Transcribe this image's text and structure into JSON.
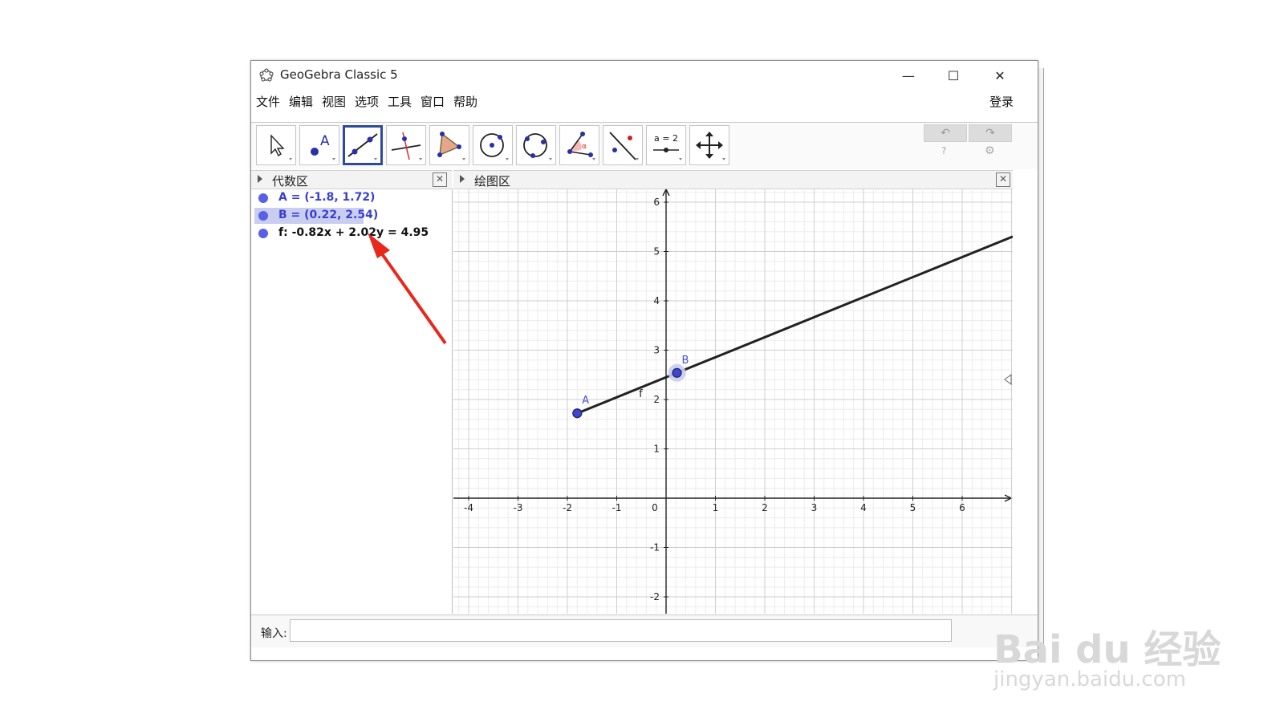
{
  "window": {
    "title": "GeoGebra Classic 5",
    "minimize_glyph": "—",
    "maximize_glyph": "☐",
    "close_glyph": "✕"
  },
  "menu": {
    "items": [
      "文件",
      "编辑",
      "视图",
      "选项",
      "工具",
      "窗口",
      "帮助"
    ],
    "login": "登录"
  },
  "toolbar": {
    "tools": [
      {
        "name": "move-tool",
        "icon": "cursor-arrow-icon"
      },
      {
        "name": "point-tool",
        "icon": "point-icon"
      },
      {
        "name": "line-tool",
        "icon": "line-through-points-icon",
        "selected": true
      },
      {
        "name": "perpendicular-line-tool",
        "icon": "perpendicular-line-icon"
      },
      {
        "name": "polygon-tool",
        "icon": "polygon-icon"
      },
      {
        "name": "circle-center-point-tool",
        "icon": "circle-center-icon"
      },
      {
        "name": "circle-three-points-tool",
        "icon": "circle-three-points-icon"
      },
      {
        "name": "angle-tool",
        "icon": "angle-icon"
      },
      {
        "name": "reflect-tool",
        "icon": "reflect-line-icon"
      },
      {
        "name": "slider-tool",
        "icon": "slider-icon",
        "label": "a = 2"
      },
      {
        "name": "move-graphics-view-tool",
        "icon": "move-cross-arrows-icon"
      }
    ],
    "undo_glyph": "↶",
    "redo_glyph": "↷",
    "help_glyph": "?",
    "settings_glyph": "⚙"
  },
  "algebra_view": {
    "title": "代数区",
    "close_glyph": "✕",
    "items": [
      {
        "text": "A = (-1.8, 1.72)",
        "color": "#3a3fcf",
        "selected": false
      },
      {
        "text": "B = (0.22, 2.54)",
        "color": "#3a3fcf",
        "selected": true
      },
      {
        "text": "f: -0.82x + 2.02y = 4.95",
        "color": "#111111",
        "selected": false
      }
    ]
  },
  "graphics_view": {
    "title": "绘图区",
    "close_glyph": "✕",
    "x_ticks": [
      "-4",
      "-3",
      "-2",
      "-1",
      "0",
      "1",
      "2",
      "3",
      "4",
      "5",
      "6"
    ],
    "y_ticks": [
      "6",
      "5",
      "4",
      "3",
      "2",
      "1",
      "-1",
      "-2"
    ],
    "point_a": {
      "label": "A",
      "x": -1.8,
      "y": 1.72
    },
    "point_b": {
      "label": "B",
      "x": 0.22,
      "y": 2.54
    },
    "line_label": "f",
    "line_color": "#222222",
    "point_color": "#3f46c8"
  },
  "input_bar": {
    "label": "输入:",
    "value": ""
  },
  "watermark": {
    "brand": "Bai du 经验",
    "url": "jingyan.baidu.com"
  },
  "annotation": {
    "arrow_color": "#e8281c"
  }
}
